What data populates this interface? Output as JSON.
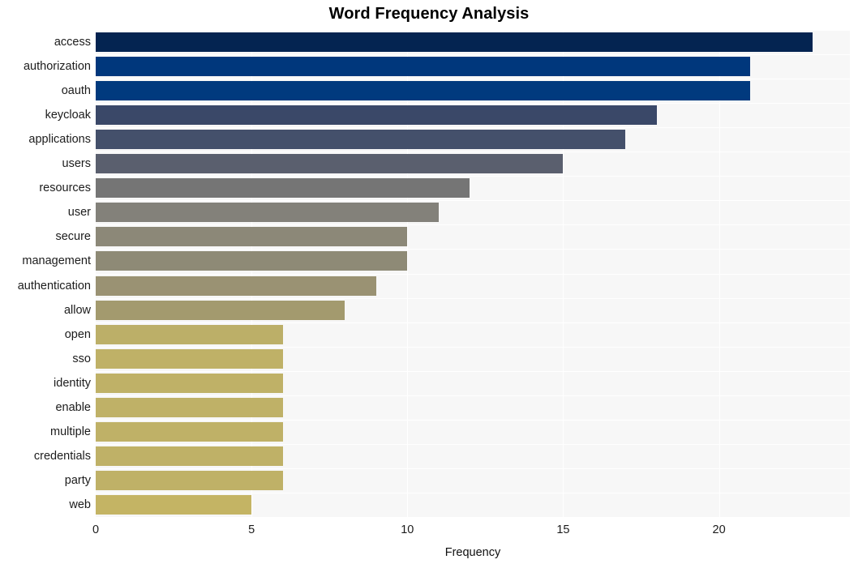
{
  "chart_data": {
    "type": "bar",
    "orientation": "horizontal",
    "title": "Word Frequency Analysis",
    "xlabel": "Frequency",
    "ylabel": "",
    "categories": [
      "access",
      "authorization",
      "oauth",
      "keycloak",
      "applications",
      "users",
      "resources",
      "user",
      "secure",
      "management",
      "authentication",
      "allow",
      "open",
      "sso",
      "identity",
      "enable",
      "multiple",
      "credentials",
      "party",
      "web"
    ],
    "values": [
      23,
      21,
      21,
      18,
      17,
      15,
      12,
      11,
      10,
      10,
      9,
      8,
      6,
      6,
      6,
      6,
      6,
      6,
      6,
      5
    ],
    "bar_colors": [
      "#042451",
      "#00377c",
      "#013a7e",
      "#3a4868",
      "#44506b",
      "#5a5f6e",
      "#757575",
      "#83817a",
      "#8c8878",
      "#8e8a76",
      "#9a9273",
      "#a39a6e",
      "#bcaf68",
      "#bfb167",
      "#bfb167",
      "#bfb167",
      "#bfb167",
      "#bfb167",
      "#bfb167",
      "#c4b464"
    ],
    "xlim": [
      0,
      24.2
    ],
    "xticks": [
      0,
      5,
      10,
      15,
      20
    ],
    "xtick_labels": [
      "0",
      "5",
      "10",
      "15",
      "20"
    ],
    "grid": true,
    "grid_color": "#ffffff",
    "plot_background": "#f7f7f7",
    "figure_background": "#ffffff",
    "legend": null
  }
}
